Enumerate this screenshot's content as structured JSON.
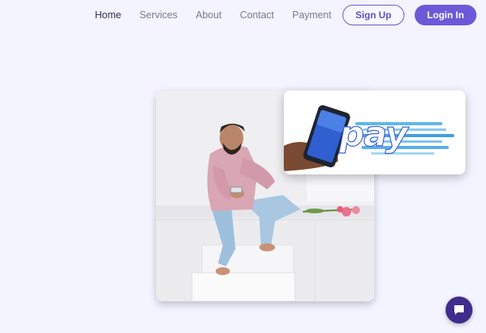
{
  "nav": {
    "links": [
      {
        "label": "Home",
        "active": true
      },
      {
        "label": "Services"
      },
      {
        "label": "About"
      },
      {
        "label": "Contact"
      },
      {
        "label": "Payment"
      }
    ],
    "signup_label": "Sign Up",
    "login_label": "Login In"
  },
  "hero": {
    "pay_word": "pay"
  },
  "colors": {
    "background": "#f3f4ff",
    "accent": "#6a5ad8",
    "chat": "#3f2c8c"
  },
  "chat": {
    "icon": "chat-bubble-icon"
  }
}
